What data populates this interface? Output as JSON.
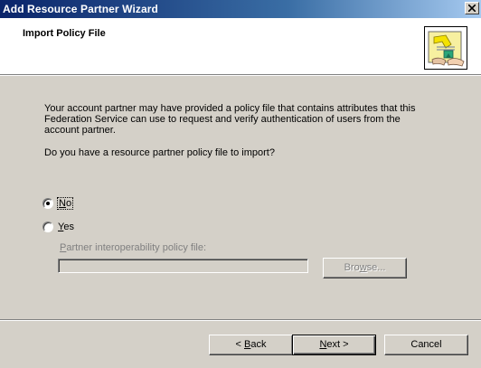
{
  "window": {
    "title": "Add Resource Partner Wizard"
  },
  "header": {
    "title": "Import Policy File",
    "icon": "policy-wizard-icon"
  },
  "body": {
    "description_lines": "Your account partner may have provided a policy file that contains attributes that this\nFederation Service can use to request and verify authentication of users from the\naccount partner.",
    "question": "Do you have a resource partner policy file to import?"
  },
  "options": {
    "selected": "No",
    "no_mnemonic": "N",
    "no_rest": "o",
    "yes_mnemonic": "Y",
    "yes_rest": "es"
  },
  "file": {
    "label_mnemonic": "P",
    "label_rest": "artner interoperability policy file:",
    "value": "",
    "browse_mnemonic": "w",
    "browse_pre": "Bro",
    "browse_post": "se..."
  },
  "buttons": {
    "back_prefix": "< ",
    "back_mnemonic": "B",
    "back_rest": "ack",
    "next_mnemonic": "N",
    "next_rest": "ext >",
    "cancel": "Cancel"
  },
  "colors": {
    "title_start": "#0a246a",
    "title_end": "#a6caf0",
    "dialog_bg": "#d4d0c8"
  }
}
